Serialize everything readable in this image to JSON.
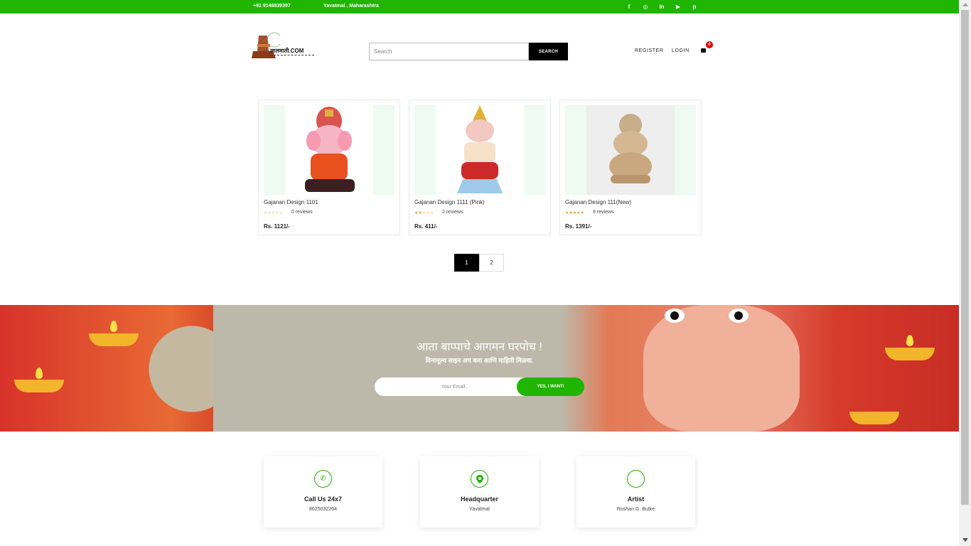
{
  "topbar": {
    "phone": "+91 9146839397",
    "location": "Yavatmal , Maharashtra",
    "social_icons": [
      "facebook-icon",
      "instagram-icon",
      "linkedin-icon",
      "youtube-icon",
      "pinterest-icon"
    ],
    "social_glyphs": [
      "f",
      "◎",
      "in",
      "▶",
      "p"
    ],
    "color": "#1fb500"
  },
  "header": {
    "logo_text": "लालमाती.COM",
    "search_placeholder": "Search",
    "search_button": "SEARCH",
    "register": "REGISTER",
    "login": "LOGIN",
    "cart_count": "0"
  },
  "products": [
    {
      "name": "Gajanan Design 1101",
      "stars": "☆☆☆☆☆",
      "reviews": "0 reviews",
      "price": "Rs. 1121/-"
    },
    {
      "name": "Gajanan Design 1111 (Pink)",
      "stars": "★★☆☆☆",
      "reviews": "2 reviews",
      "price": "Rs. 411/-"
    },
    {
      "name": "Gajanan Design 111(New)",
      "stars": "★★★★★",
      "reviews": "9 reviews",
      "price": "Rs. 1391/-"
    }
  ],
  "pagination": {
    "pages": [
      "1",
      "2"
    ],
    "current": "1"
  },
  "banner": {
    "title": "आता बाप्पाचे आगमन घरपोच !",
    "subtitle": "विनामूल्य साइन अप करा आणि माहिती मिळवा.",
    "email_placeholder": "Your Email..",
    "button": "YES, I WANT!"
  },
  "contacts": [
    {
      "icon": "phone-icon",
      "glyph": "✆",
      "title": "Call Us 24x7",
      "value": "8625032264"
    },
    {
      "icon": "location-pin-icon",
      "glyph": "⬤",
      "title": "Headquarter",
      "value": "Yavatmal"
    },
    {
      "icon": "artist-icon",
      "glyph": "",
      "title": "Artist",
      "value": "Roshan G. Butke"
    }
  ]
}
